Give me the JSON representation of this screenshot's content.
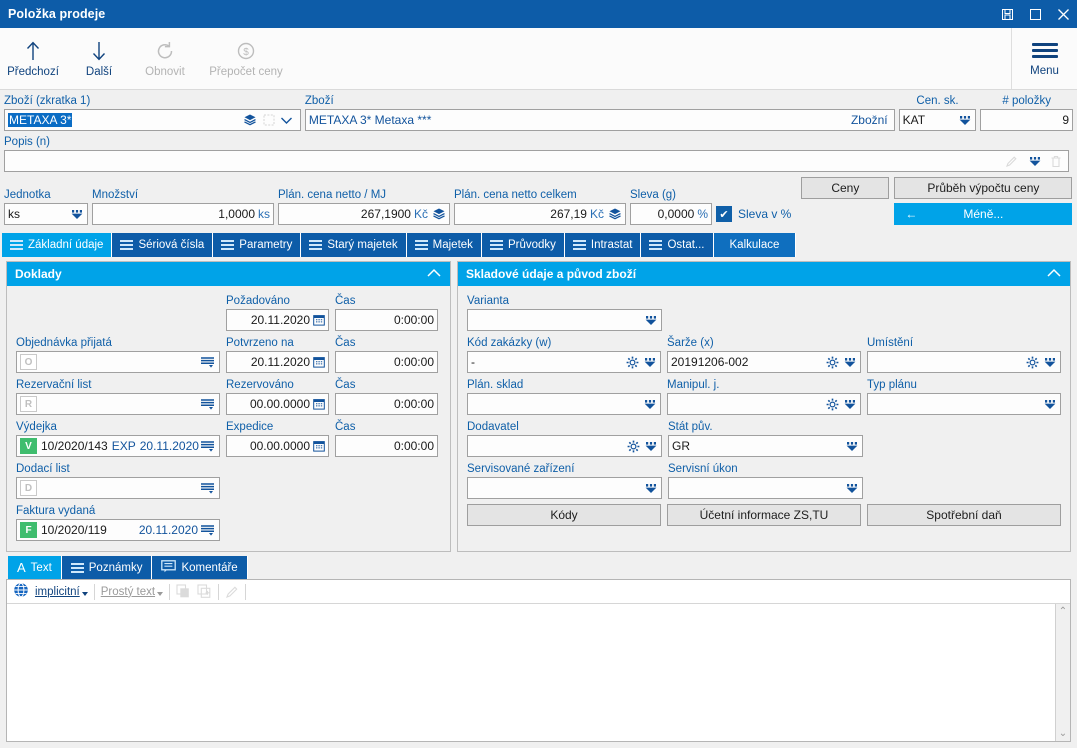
{
  "window": {
    "title": "Položka prodeje",
    "controls": [
      {
        "name": "restore-down",
        "glyph": "❏"
      },
      {
        "name": "maximize",
        "glyph": "▢"
      },
      {
        "name": "close",
        "glyph": "✕"
      }
    ]
  },
  "toolbar": {
    "buttons": [
      {
        "label": "Předchozí",
        "icon": "arrow-up-icon",
        "glyph": "↑",
        "disabled": false
      },
      {
        "label": "Další",
        "icon": "arrow-down-icon",
        "glyph": "↓",
        "disabled": false
      },
      {
        "label": "Obnovit",
        "icon": "refresh-icon",
        "glyph": "⟳",
        "disabled": true
      },
      {
        "label": "Přepočet ceny",
        "icon": "recalculate-price-icon",
        "glyph": "⟳",
        "disabled": true
      }
    ],
    "menu_label": "Menu"
  },
  "header": {
    "goods_code": {
      "label": "Zboží (zkratka 1)",
      "accel": "Z",
      "value": "METAXA 3*"
    },
    "goods_name": {
      "label": "Zboží",
      "value": "METAXA 3* Metaxa ***",
      "suffix": "Zbožní"
    },
    "price_group": {
      "label": "Cen. sk.",
      "value": "KAT"
    },
    "item_number": {
      "label": "# položky",
      "value": "9"
    },
    "description": {
      "label": "Popis (n)",
      "value": ""
    }
  },
  "pricing": {
    "unit": {
      "label": "Jednotka",
      "accel": "J",
      "value": "ks"
    },
    "quantity": {
      "label": "Množství",
      "accel": "M",
      "value": "1,0000",
      "unit": "ks"
    },
    "unit_price": {
      "label": "Plán. cena netto / MJ",
      "accel": "c",
      "value": "267,1900",
      "currency": "Kč"
    },
    "total_price": {
      "label": "Plán. cena netto celkem",
      "value": "267,19",
      "currency": "Kč"
    },
    "discount": {
      "label": "Sleva (g)",
      "value": "0,0000",
      "unit": "%"
    },
    "discount_pct_checkbox": {
      "label": "Sleva v %",
      "checked": true
    },
    "prices_button": "Ceny",
    "price_calc_button": "Průběh výpočtu ceny",
    "less_button": "Méně..."
  },
  "tabs": [
    {
      "label": "Základní údaje",
      "state": "active"
    },
    {
      "label": "Sériová čísla",
      "state": "normal"
    },
    {
      "label": "Parametry",
      "state": "normal"
    },
    {
      "label": "Starý majetek",
      "state": "normal"
    },
    {
      "label": "Majetek",
      "state": "normal"
    },
    {
      "label": "Průvodky",
      "state": "normal"
    },
    {
      "label": "Intrastat",
      "state": "normal"
    },
    {
      "label": "Ostat...",
      "state": "normal"
    },
    {
      "label": "Kalkulace",
      "state": "lite"
    }
  ],
  "documents_panel": {
    "title": "Doklady",
    "requested": {
      "label": "Požadováno",
      "value": "20.11.2020"
    },
    "requested_time": {
      "label": "Čas",
      "value": "0:00:00"
    },
    "order_received": {
      "label": "Objednávka přijatá",
      "prefix": "O",
      "value": ""
    },
    "confirmed_on": {
      "label": "Potvrzeno na",
      "value": "20.11.2020"
    },
    "confirmed_time": {
      "label": "Čas",
      "value": "0:00:00"
    },
    "reservation_sheet": {
      "label": "Rezervační list",
      "prefix": "R",
      "value": ""
    },
    "reserved": {
      "label": "Rezervováno",
      "value": "00.00.0000"
    },
    "reserved_time": {
      "label": "Čas",
      "value": "0:00:00"
    },
    "delivery_note_out": {
      "label": "Výdejka",
      "prefix": "V",
      "value": "10/2020/143",
      "extra": "EXP",
      "date": "20.11.2020"
    },
    "expedition": {
      "label": "Expedice",
      "value": "00.00.0000"
    },
    "expedition_time": {
      "label": "Čas",
      "value": "0:00:00"
    },
    "delivery_note": {
      "label": "Dodací list",
      "prefix": "D",
      "value": ""
    },
    "invoice_issued": {
      "label": "Faktura vydaná",
      "prefix": "F",
      "value": "10/2020/119",
      "date": "20.11.2020"
    }
  },
  "stock_panel": {
    "title": "Skladové údaje a původ zboží",
    "variant": {
      "label": "Varianta",
      "accel": "V",
      "value": ""
    },
    "order_code": {
      "label": "Kód zakázky (w)",
      "value": "-"
    },
    "batch": {
      "label": "Šarže (x)",
      "value": "20191206-002"
    },
    "location": {
      "label": "Umístění",
      "accel": "U",
      "value": ""
    },
    "plan_warehouse": {
      "label": "Plán. sklad",
      "value": ""
    },
    "handling_unit": {
      "label": "Manipul. j.",
      "value": ""
    },
    "plan_type": {
      "label": "Typ plánu",
      "value": ""
    },
    "supplier": {
      "label": "Dodavatel",
      "value": ""
    },
    "country_of_origin": {
      "label": "Stát pův.",
      "value": "GR"
    },
    "serviced_device": {
      "label": "Servisované zařízení",
      "value": ""
    },
    "service_action": {
      "label": "Servisní úkon",
      "value": ""
    },
    "buttons": [
      "Kódy",
      "Účetní informace ZS,TU",
      "Spotřební daň"
    ]
  },
  "notes": {
    "tabs": [
      {
        "label": "Text",
        "icon": "text-icon",
        "glyph": "A",
        "state": "active"
      },
      {
        "label": "Poznámky",
        "icon": "lines-icon",
        "state": "normal"
      },
      {
        "label": "Komentáře",
        "icon": "comment-icon",
        "glyph": "🗨",
        "state": "normal"
      }
    ],
    "editor_toolbar": {
      "language": "implicitní",
      "format": "Prostý text",
      "copy_icon": "copy-icon",
      "paste_icon": "paste-add-icon",
      "edit_icon": "pencil-icon"
    },
    "content": ""
  },
  "colors": {
    "title_bar": "#0d5ca8",
    "panel_header": "#00a3e8",
    "label_blue": "#0f5fa8",
    "accent_green": "#3fbd6e"
  }
}
